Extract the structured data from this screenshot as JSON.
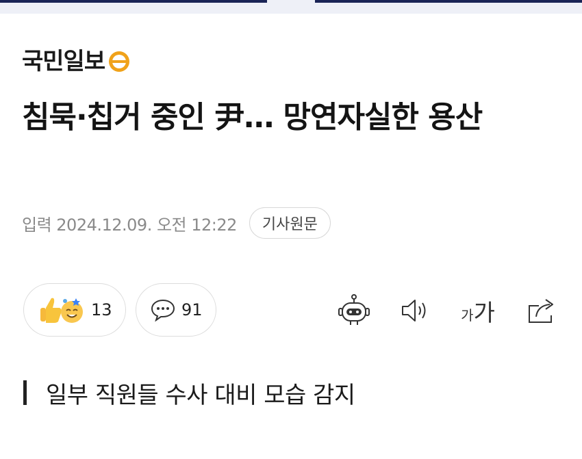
{
  "publisher": {
    "name": "국민일보",
    "logo_icon": "kmib-circle-logo"
  },
  "article": {
    "headline": "침묵·칩거 중인 尹… 망연자실한 용산",
    "date_label": "입력 2024.12.09. 오전 12:22",
    "original_button": "기사원문",
    "subheading": "일부 직원들 수사 대비 모습 감지"
  },
  "reactions": {
    "icon": "reaction-emoji-icon",
    "count": "13"
  },
  "comments": {
    "icon": "comment-bubble-icon",
    "count": "91"
  },
  "toolbar": {
    "bot_icon": "summary-bot-icon",
    "speaker_icon": "speaker-icon",
    "font_small": "가",
    "font_big": "가",
    "share_icon": "share-icon"
  },
  "colors": {
    "accent_navy": "#1a2456",
    "logo_orange": "#f0a21a"
  }
}
